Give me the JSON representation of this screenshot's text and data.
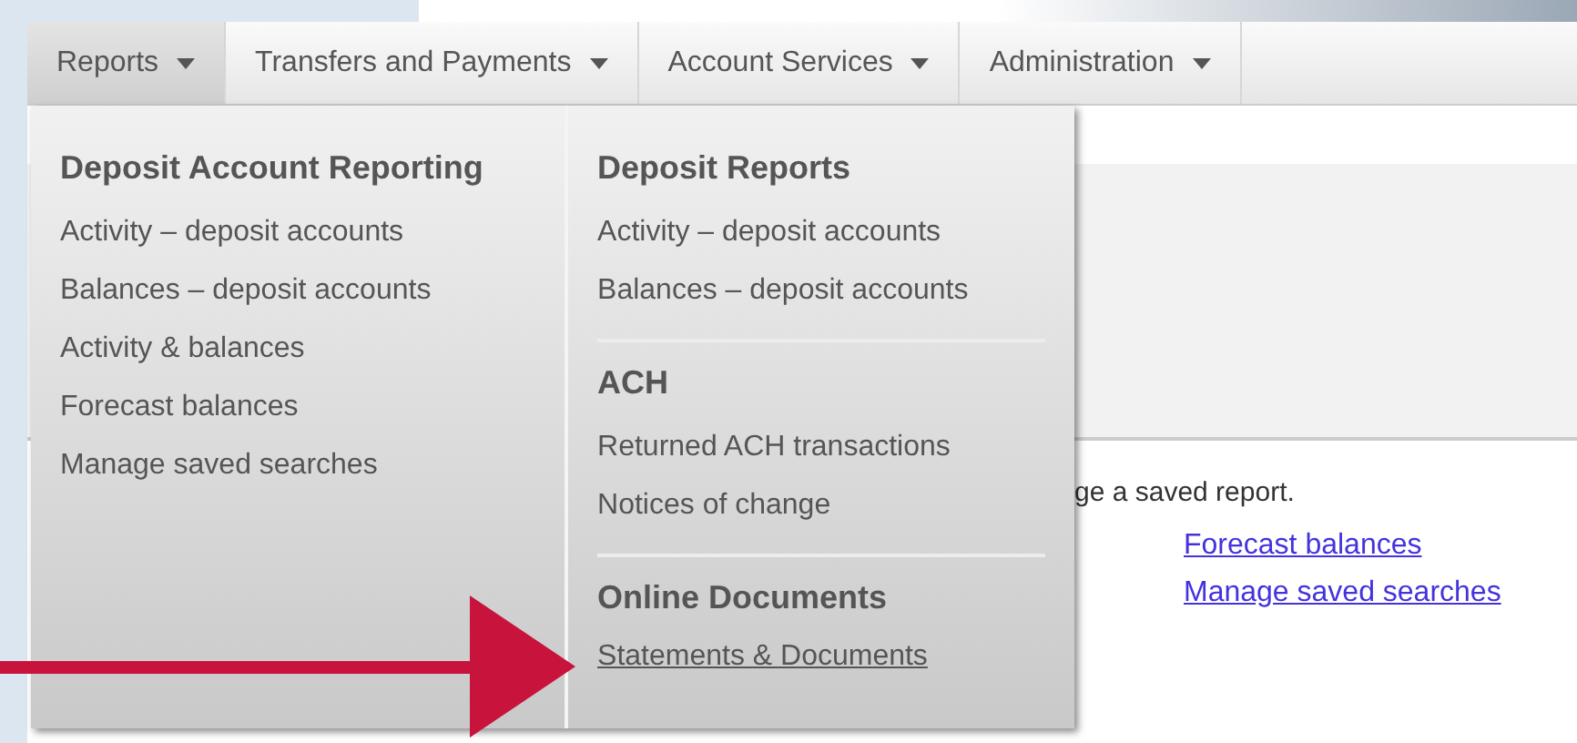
{
  "nav_tabs": [
    {
      "label": "Reports",
      "selected": true
    },
    {
      "label": "Transfers and Payments",
      "selected": false
    },
    {
      "label": "Account Services",
      "selected": false
    },
    {
      "label": "Administration",
      "selected": false
    }
  ],
  "menu": {
    "columns": [
      {
        "sections": [
          {
            "heading": "Deposit Account Reporting",
            "items": [
              {
                "label": "Activity – deposit accounts",
                "hovered": false
              },
              {
                "label": "Balances – deposit accounts",
                "hovered": false
              },
              {
                "label": "Activity & balances",
                "hovered": false
              },
              {
                "label": "Forecast balances",
                "hovered": false
              },
              {
                "label": "Manage saved searches",
                "hovered": false
              }
            ]
          }
        ]
      },
      {
        "sections": [
          {
            "heading": "Deposit Reports",
            "items": [
              {
                "label": "Activity – deposit accounts",
                "hovered": false
              },
              {
                "label": "Balances – deposit accounts",
                "hovered": false
              }
            ]
          },
          {
            "heading": "ACH",
            "items": [
              {
                "label": "Returned ACH transactions",
                "hovered": false
              },
              {
                "label": "Notices of change",
                "hovered": false
              }
            ]
          },
          {
            "heading": "Online Documents",
            "items": [
              {
                "label": "Statements & Documents",
                "hovered": true
              }
            ]
          }
        ]
      }
    ]
  },
  "content": {
    "text": "ge a saved report.",
    "links": [
      "Forecast balances",
      "Manage saved searches"
    ]
  }
}
